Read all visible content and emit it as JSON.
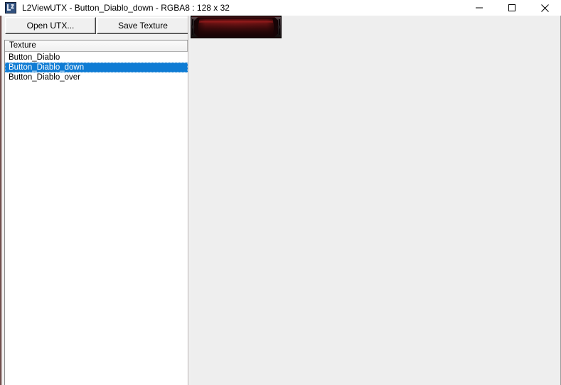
{
  "window": {
    "title": "L2ViewUTX - Button_Diablo_down - RGBA8 : 128 x 32",
    "icon_name": "l2-app-icon",
    "controls": {
      "minimize_label": "Minimize",
      "maximize_label": "Maximize",
      "close_label": "Close"
    }
  },
  "toolbar": {
    "open_label": "Open UTX...",
    "save_label": "Save Texture"
  },
  "texture_list": {
    "header": "Texture",
    "items": [
      {
        "label": "Button_Diablo",
        "selected": false
      },
      {
        "label": "Button_Diablo_down",
        "selected": true
      },
      {
        "label": "Button_Diablo_over",
        "selected": false
      }
    ],
    "selection_color": "#0f7cd4"
  },
  "preview": {
    "name": "Button_Diablo_down",
    "format": "RGBA8",
    "width": 128,
    "height": 32,
    "dimensions_label": "128 x 32",
    "colors": {
      "background": "#eeeeee",
      "body_highlight": "#7a1414",
      "body_mid": "#4a0c0c",
      "body_dark": "#1d0505",
      "frame": "#140507",
      "bracket": "#2b2124"
    }
  }
}
